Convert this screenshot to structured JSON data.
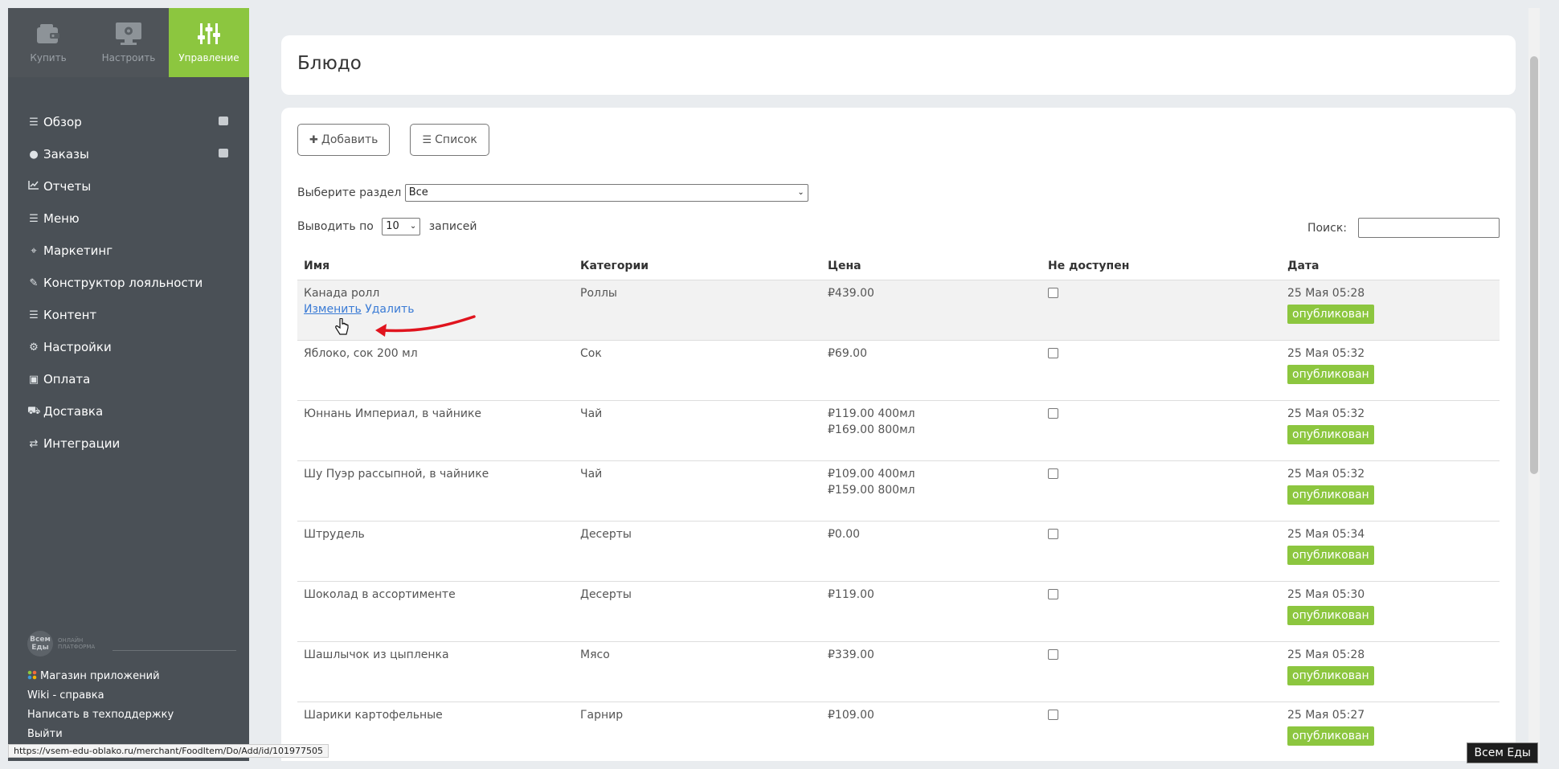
{
  "sidebar": {
    "tabs": [
      {
        "label": "Купить",
        "icon": "wallet-icon"
      },
      {
        "label": "Настроить",
        "icon": "monitor-gear-icon"
      },
      {
        "label": "Управление",
        "icon": "sliders-icon"
      }
    ],
    "items": [
      {
        "label": "Обзор",
        "icon": "list-icon",
        "glyph": "☰"
      },
      {
        "label": "Заказы",
        "icon": "circle-icon",
        "glyph": "●"
      },
      {
        "label": "Отчеты",
        "icon": "chart-line-icon",
        "glyph": "📈"
      },
      {
        "label": "Меню",
        "icon": "list-icon",
        "glyph": "☰"
      },
      {
        "label": "Маркетинг",
        "icon": "crosshair-icon",
        "glyph": "⌖"
      },
      {
        "label": "Конструктор лояльности",
        "icon": "magic-wand-icon",
        "glyph": "✎"
      },
      {
        "label": "Контент",
        "icon": "list-icon",
        "glyph": "☰"
      },
      {
        "label": "Настройки",
        "icon": "gear-icon",
        "glyph": "⚙"
      },
      {
        "label": "Оплата",
        "icon": "money-icon",
        "glyph": "▣"
      },
      {
        "label": "Доставка",
        "icon": "truck-icon",
        "glyph": "⛟"
      },
      {
        "label": "Интеграции",
        "icon": "exchange-icon",
        "glyph": "⇄"
      }
    ],
    "brand": {
      "logo": "Всем Еды",
      "tagline": "ОНЛАЙН ПЛАТФОРМА"
    },
    "footer": {
      "apps": "Магазин приложений",
      "wiki": "Wiki - справка",
      "support": "Написать в техподдержку",
      "logout": "Выйти"
    }
  },
  "page": {
    "title": "Блюдо",
    "add_button": "Добавить",
    "list_button": "Список",
    "section_label": "Выберите раздел",
    "section_value": "Все",
    "perpage_label": "Выводить по",
    "perpage_value": "10",
    "perpage_suffix": "записей",
    "search_label": "Поиск:"
  },
  "table": {
    "headers": [
      "Имя",
      "Категории",
      "Цена",
      "Не доступен",
      "Дата"
    ],
    "edit_label": "Изменить",
    "delete_label": "Удалить",
    "rows": [
      {
        "name": "Канада ролл",
        "category": "Роллы",
        "price1": "₽439.00",
        "price2": "",
        "date": "25 Мая 05:28",
        "status": "опубликован"
      },
      {
        "name": "Яблоко, сок 200 мл",
        "category": "Сок",
        "price1": "₽69.00",
        "price2": "",
        "date": "25 Мая 05:32",
        "status": "опубликован"
      },
      {
        "name": "Юннань Империал, в чайнике",
        "category": "Чай",
        "price1": "₽119.00 400мл",
        "price2": "₽169.00 800мл",
        "date": "25 Мая 05:32",
        "status": "опубликован"
      },
      {
        "name": "Шу Пуэр рассыпной, в чайнике",
        "category": "Чай",
        "price1": "₽109.00 400мл",
        "price2": "₽159.00 800мл",
        "date": "25 Мая 05:32",
        "status": "опубликован"
      },
      {
        "name": "Штрудель",
        "category": "Десерты",
        "price1": "₽0.00",
        "price2": "",
        "date": "25 Мая 05:34",
        "status": "опубликован"
      },
      {
        "name": "Шоколад в ассортименте",
        "category": "Десерты",
        "price1": "₽119.00",
        "price2": "",
        "date": "25 Мая 05:30",
        "status": "опубликован"
      },
      {
        "name": "Шашлычок из цыпленка",
        "category": "Мясо",
        "price1": "₽339.00",
        "price2": "",
        "date": "25 Мая 05:28",
        "status": "опубликован"
      },
      {
        "name": "Шарики картофельные",
        "category": "Гарнир",
        "price1": "₽109.00",
        "price2": "",
        "date": "25 Мая 05:27",
        "status": "опубликован"
      }
    ]
  },
  "status_bar": {
    "url": "https://vsem-edu-oblako.ru/merchant/FoodItem/Do/Add/id/101977505"
  },
  "chat_chip": "Всем Еды",
  "colors": {
    "accent": "#8cc63f",
    "sidebar": "#4a5056",
    "link": "#3a7bd5",
    "arrow": "#e0141e"
  }
}
